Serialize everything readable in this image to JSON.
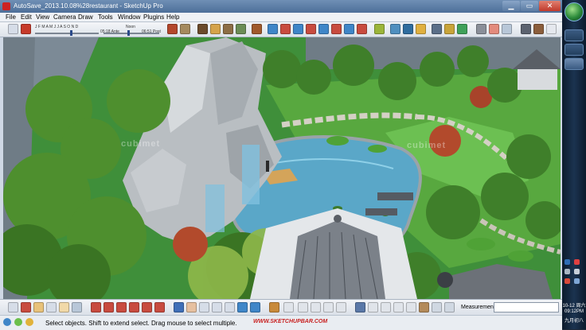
{
  "window": {
    "title": "AutoSave_2013.10.08%28restaurant - SketchUp Pro"
  },
  "menu": [
    "File",
    "Edit",
    "View",
    "Camera",
    "Draw",
    "Tools",
    "Window",
    "Plugins",
    "Help"
  ],
  "shadows": {
    "months": "J F M A M J J A S O N D",
    "time_start": "05:18 Ante",
    "noon": "Noon",
    "time_end": "06:51 Post"
  },
  "viewport": {
    "watermark_left": "cubimet",
    "watermark_right": "cubimet"
  },
  "measurements": {
    "label": "Measurements",
    "value": ""
  },
  "status": {
    "message": "Select objects. Shift to extend select. Drag mouse to select multiple.",
    "watermark": "WWW.SKETCHUPBAR.COM"
  },
  "clock": {
    "date": "10-12 周六",
    "time": "09:12PM",
    "lunar": "九月初八"
  },
  "colors": {
    "title_bar": "#4d6f99",
    "menu_bg": "#eef1f5",
    "taskbar": "#0c1a2c",
    "water": "#5aa7c8",
    "grass": "#3f8f3a",
    "status_watermark": "#c82020"
  }
}
